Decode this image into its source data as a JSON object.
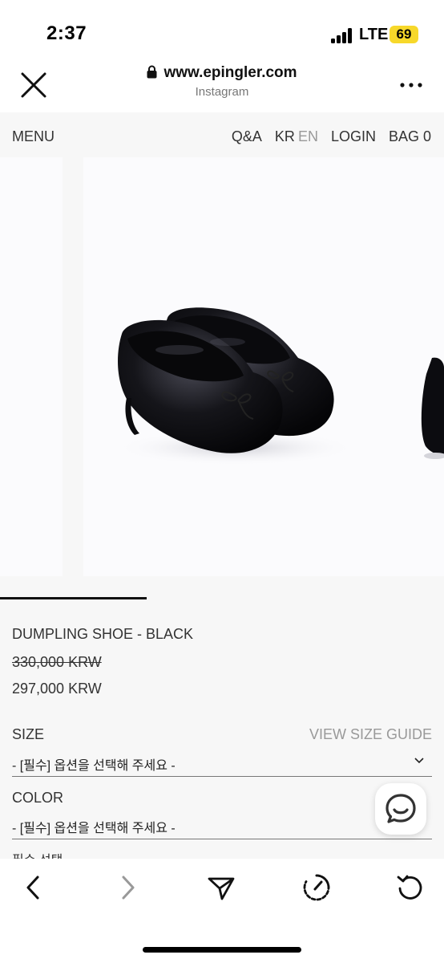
{
  "status": {
    "time": "2:37",
    "network": "LTE",
    "battery": "69"
  },
  "browser": {
    "url": "www.epingler.com",
    "source": "Instagram"
  },
  "nav": {
    "menu": "MENU",
    "qa": "Q&A",
    "lang_kr": "KR",
    "lang_en": "EN",
    "login": "LOGIN",
    "bag": "BAG 0"
  },
  "gallery": {
    "progress_fraction": 0.33
  },
  "product": {
    "name": "DUMPLING SHOE - BLACK",
    "original_price": "330,000 KRW",
    "sale_price": "297,000 KRW"
  },
  "options": {
    "size_label": "SIZE",
    "size_guide": "VIEW SIZE GUIDE",
    "size_placeholder": "- [필수] 옵션을 선택해 주세요 -",
    "color_label": "COLOR",
    "color_placeholder": "- [필수] 옵션을 선택해 주세요 -",
    "partial_label": "필수 선택"
  },
  "icons": {
    "close": "close-icon",
    "lock": "lock-icon",
    "more": "more-icon",
    "back": "chevron-left-icon",
    "forward": "chevron-right-icon",
    "share": "send-icon",
    "speed": "speed-icon",
    "reload": "reload-icon",
    "chat": "chat-icon"
  },
  "colors": {
    "battery": "#f7d82a",
    "text": "#333333",
    "muted": "#999999"
  }
}
